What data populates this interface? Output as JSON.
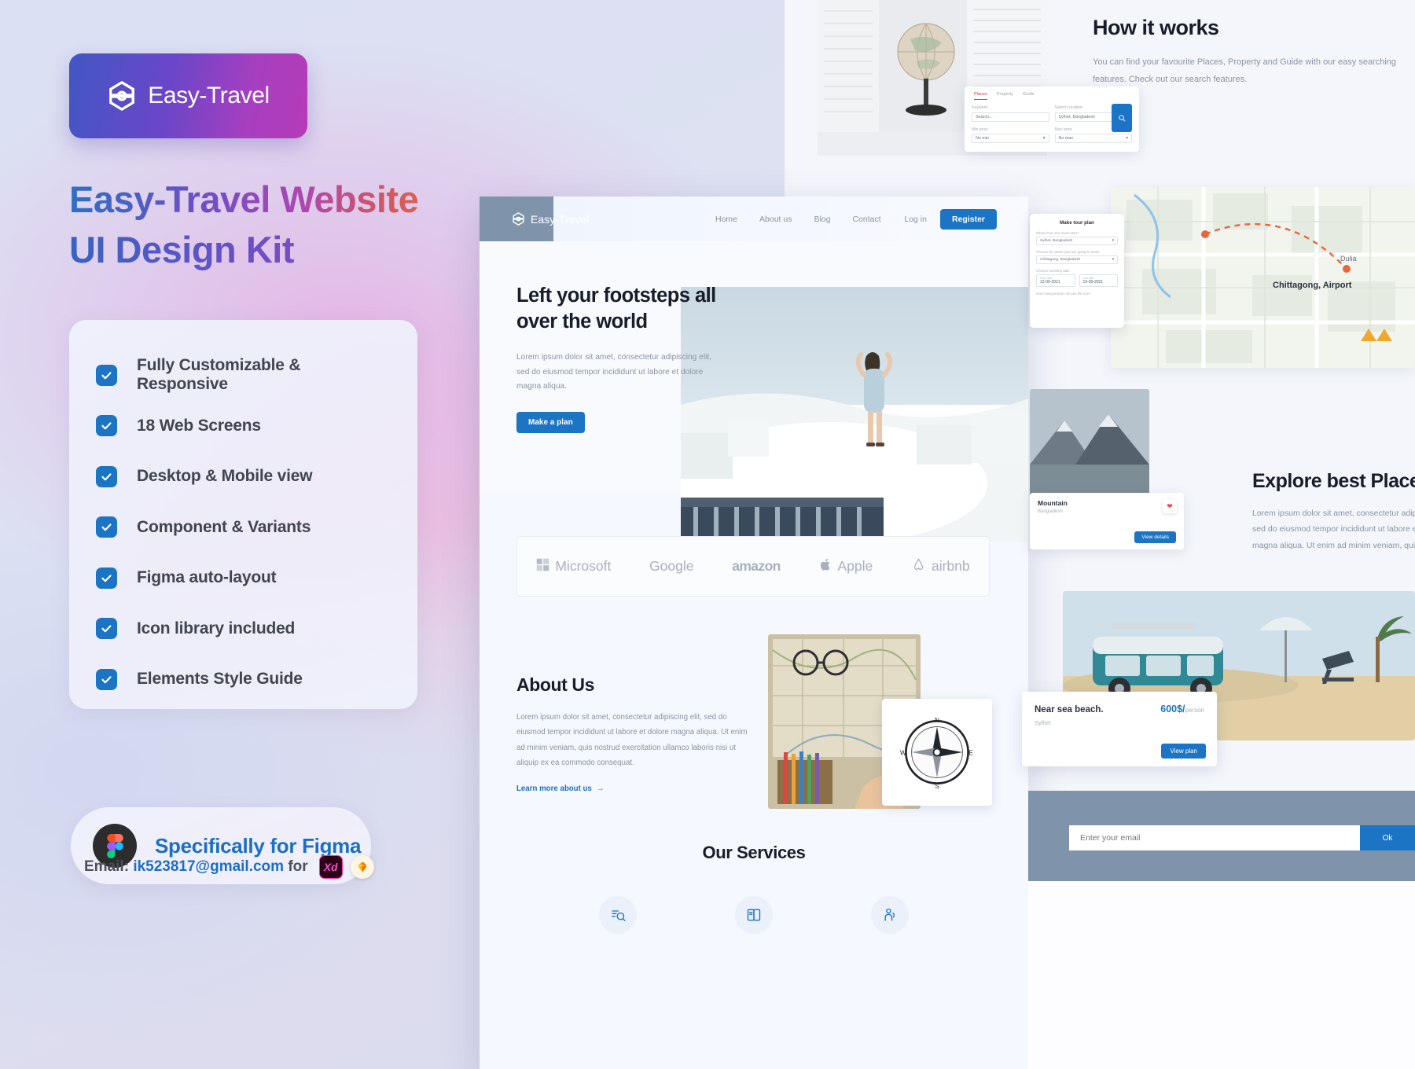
{
  "brand": {
    "logo_text": "Easy-Travel",
    "logo_icon": "compass-hexagon-icon"
  },
  "left_panel": {
    "title_line1": "Easy-Travel Website",
    "title_line2": "UI Design Kit",
    "features": [
      "Fully Customizable & Responsive",
      "18 Web Screens",
      "Desktop & Mobile view",
      "Component & Variants",
      "Figma auto-layout",
      "Icon library included",
      "Elements Style Guide"
    ],
    "figma_badge": "Specifically for Figma",
    "email_prefix": "Email:",
    "email_address": "ik523817@gmail.com",
    "email_suffix": "for",
    "badge_xd": "Xd",
    "badge_sketch": "sketch-diamond-icon"
  },
  "browser": {
    "nav": {
      "links": [
        "Home",
        "About us",
        "Blog",
        "Contact"
      ],
      "login": "Log in",
      "register": "Register"
    },
    "hero": {
      "heading_line1": "Left your footsteps all",
      "heading_line2": "over the world",
      "paragraph": "Lorem ipsum dolor sit amet, consectetur adipiscing elit, sed do eiusmod tempor incididunt ut labore et dolore magna aliqua.",
      "cta": "Make a plan"
    },
    "brands": [
      "Microsoft",
      "Google",
      "amazon",
      "Apple",
      "airbnb"
    ],
    "about": {
      "heading": "About Us",
      "paragraph": "Lorem ipsum dolor sit amet, consectetur adipiscing elit, sed do eiusmod tempor incididunt ut labore et dolore magna aliqua. Ut enim ad minim veniam, quis nostrud exercitation ullamco laboris nisi ut aliquip ex ea commodo consequat.",
      "link": "Learn more about us"
    },
    "services": {
      "heading": "Our Services",
      "icons": [
        "search-document-icon",
        "ticket-icon",
        "guide-person-icon"
      ]
    }
  },
  "right_panels": {
    "how_it_works": {
      "heading": "How it works",
      "paragraph": "You can find your favourite Places, Property and Guide with our easy searching features. Check out our search features."
    },
    "search_panel": {
      "tabs": [
        "Places",
        "Property",
        "Guide"
      ],
      "active_tab": "Places",
      "keyword_label": "Keyword",
      "keyword_placeholder": "Search...",
      "location_label": "Select Location",
      "location_value": "Sylhet, Bangladesh",
      "minprice_label": "Min price",
      "minprice_value": "No min",
      "maxprice_label": "Max price",
      "maxprice_value": "No max",
      "search_icon": "search-icon"
    },
    "tour_panel": {
      "title": "Make tour plan",
      "from_label": "Where from the travel start?",
      "from_value": "Sylhet, Bangladesh",
      "to_label": "Choose the place your are going to travel",
      "to_value": "Chittagong, Bangladesh",
      "date_label": "Choose traveling date",
      "start_label": "Start date",
      "start_value": "12-09-2021",
      "end_label": "End date",
      "end_value": "19-09-2021",
      "people_label": "How many people can join the tour?"
    },
    "map_labels": [
      "Chittagong, Airport"
    ],
    "explore": {
      "heading": "Explore best Places",
      "paragraph": "Lorem ipsum dolor sit amet, consectetur adipiscing elit, sed do eiusmod tempor incididunt ut labore et dolore magna aliqua. Ut enim ad minim veniam, quis."
    },
    "mountain_card": {
      "title": "Mountain",
      "subtitle": "Bangladesh",
      "button": "View details",
      "favorite_icon": "heart-icon"
    },
    "beach_card": {
      "title": "Near sea beach.",
      "price": "600$/",
      "per": "person",
      "subtitle": "Sylhet",
      "button": "View plan"
    },
    "newsletter": {
      "placeholder": "Enter your email",
      "button": "Ok"
    }
  },
  "colors": {
    "accent_blue": "#1b74c4",
    "slate": "#7f94ab",
    "dark_text": "#181d29",
    "muted": "#8b93a3"
  }
}
